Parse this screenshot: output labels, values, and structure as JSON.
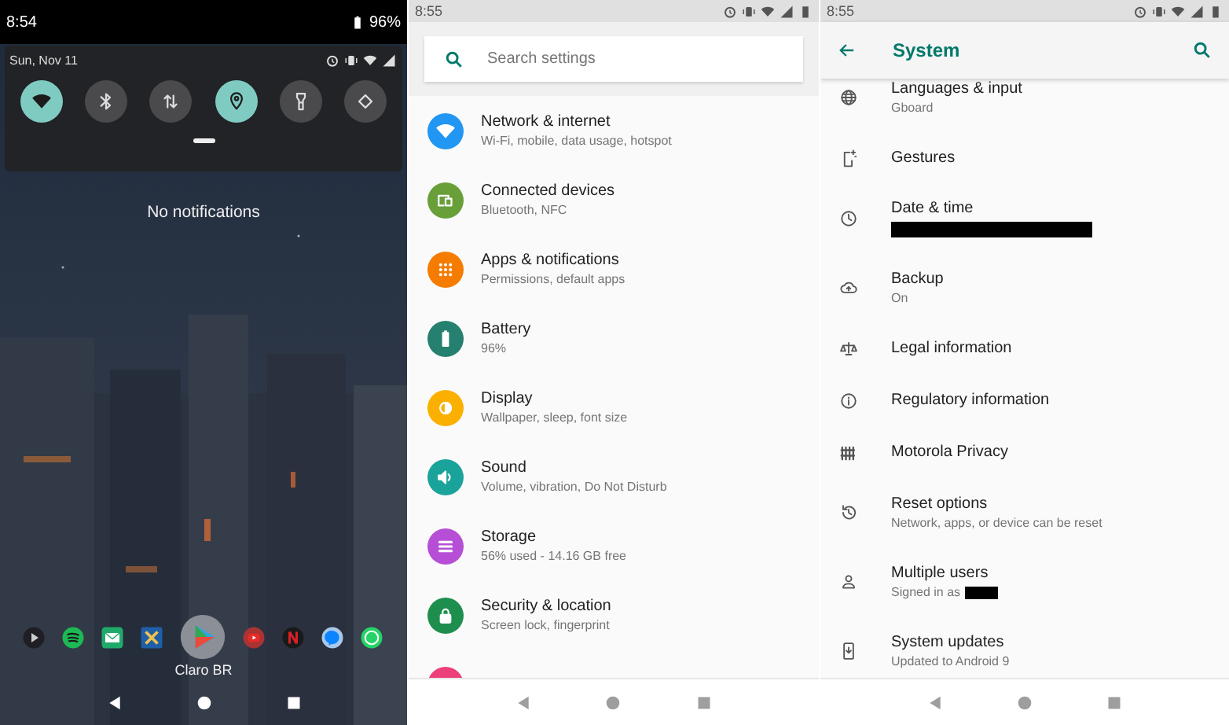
{
  "notification_shade": {
    "status_bar": {
      "time": "8:54",
      "battery": "96%"
    },
    "date": "Sun, Nov 11",
    "tiles": [
      {
        "kind": "wifi",
        "on": true
      },
      {
        "kind": "bluetooth",
        "on": false
      },
      {
        "kind": "data",
        "on": false
      },
      {
        "kind": "location",
        "on": true
      },
      {
        "kind": "flashlight",
        "on": false
      },
      {
        "kind": "rotate",
        "on": false
      }
    ],
    "empty_message": "No notifications",
    "dock_label": "Claro BR"
  },
  "settings_home": {
    "status_bar": {
      "time": "8:55"
    },
    "search": {
      "placeholder": "Search settings"
    },
    "items": [
      {
        "kind": "wifi",
        "color": "#2196f3",
        "title": "Network & internet",
        "subtitle": "Wi-Fi, mobile, data usage, hotspot"
      },
      {
        "kind": "devices",
        "color": "#689f38",
        "title": "Connected devices",
        "subtitle": "Bluetooth, NFC"
      },
      {
        "kind": "apps",
        "color": "#f57c00",
        "title": "Apps & notifications",
        "subtitle": "Permissions, default apps"
      },
      {
        "kind": "battery",
        "color": "#26806f",
        "title": "Battery",
        "subtitle": "96%"
      },
      {
        "kind": "display",
        "color": "#fbb000",
        "title": "Display",
        "subtitle": "Wallpaper, sleep, font size"
      },
      {
        "kind": "sound",
        "color": "#1aa39a",
        "title": "Sound",
        "subtitle": "Volume, vibration, Do Not Disturb"
      },
      {
        "kind": "storage",
        "color": "#b74fd6",
        "title": "Storage",
        "subtitle": "56% used - 14.16 GB free"
      },
      {
        "kind": "lock",
        "color": "#1e8e4e",
        "title": "Security & location",
        "subtitle": "Screen lock, fingerprint"
      },
      {
        "kind": "user",
        "color": "#ec407a"
      }
    ]
  },
  "system_settings": {
    "status_bar": {
      "time": "8:55"
    },
    "title": "System",
    "items": [
      {
        "kind": "globe",
        "title": "Languages & input",
        "subtitle": "Gboard"
      },
      {
        "kind": "gestures",
        "title": "Gestures"
      },
      {
        "kind": "clock",
        "title": "Date & time",
        "redacted": true
      },
      {
        "kind": "cloud",
        "title": "Backup",
        "subtitle": "On"
      },
      {
        "kind": "legal",
        "title": "Legal information"
      },
      {
        "kind": "info",
        "title": "Regulatory information"
      },
      {
        "kind": "fence",
        "title": "Motorola Privacy"
      },
      {
        "kind": "history",
        "title": "Reset options",
        "subtitle": "Network, apps, or device can be reset"
      },
      {
        "kind": "person",
        "title": "Multiple users",
        "subtitle": "Signed in as",
        "redacted": true
      },
      {
        "kind": "update",
        "title": "System updates",
        "subtitle": "Updated to Android 9"
      }
    ]
  }
}
